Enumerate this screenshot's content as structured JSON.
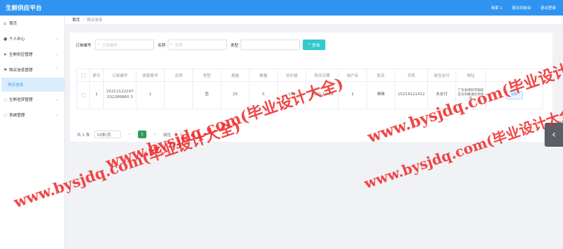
{
  "app": {
    "title": "生鲜供应平台",
    "user_label": "商家 1",
    "back_label": "退出到前台",
    "logout_label": "退出登录"
  },
  "sidebar": {
    "items": [
      {
        "icon": "home-icon",
        "label": "首页"
      },
      {
        "icon": "user-icon",
        "label": "个人中心"
      },
      {
        "icon": "send-icon",
        "label": "生鲜供应管理"
      },
      {
        "icon": "flag-icon",
        "label": "购买信息管理"
      },
      {
        "icon": "chat-icon",
        "label": "生鲜进货管理"
      },
      {
        "icon": "chat-icon",
        "label": "系统管理"
      }
    ],
    "active_sub": "购买信息"
  },
  "breadcrumb": {
    "home": "首页",
    "current": "购买信息"
  },
  "search": {
    "order_label": "订单编号",
    "order_placeholder": "订单编号",
    "name_label": "名称",
    "name_placeholder": "名称",
    "type_label": "类型",
    "query_label": "查询"
  },
  "table": {
    "headers": [
      "索引",
      "订单编号",
      "商家账号",
      "名称",
      "类型",
      "规格",
      "数量",
      "总价格",
      "购买日期",
      "用户名",
      "姓名",
      "手机",
      "是否支付",
      "地址",
      ""
    ],
    "rows": [
      [
        "1",
        "20211122247332286860 3",
        "1",
        "",
        "鱼",
        "25",
        "5",
        "125",
        "2020-12-28",
        "1",
        "琳琳",
        "15214121412",
        "未支付",
        "广东省揭阳市榕城区东阳路通达商场电",
        "详情"
      ]
    ]
  },
  "pagination": {
    "total": "共 1 条",
    "page_size": "10条/页",
    "prev": "<",
    "page": "1",
    "next": ">",
    "goto": "前往",
    "goto_value": "1",
    "page_unit": "页"
  },
  "watermark": {
    "text": "www.bysjdq.com(毕业设计大全)"
  }
}
